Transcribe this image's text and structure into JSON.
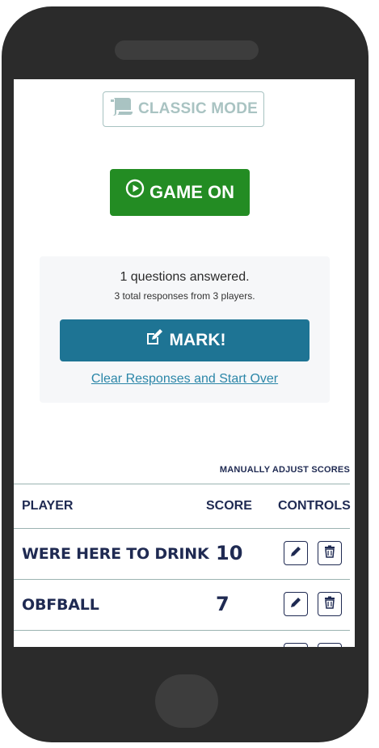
{
  "classic_mode": {
    "label": "CLASSIC MODE",
    "icon": "scroll-icon"
  },
  "game_on": {
    "label": "GAME ON",
    "icon": "play-circle-icon",
    "color": "#238c23"
  },
  "stats": {
    "questions_answered": "1 questions answered.",
    "responses": "3 total responses from 3 players.",
    "mark_label": "MARK!",
    "mark_icon": "edit-icon",
    "mark_color": "#1e7494",
    "clear_link": "Clear Responses and Start Over"
  },
  "scores": {
    "manual_adjust": "MANUALLY ADJUST SCORES",
    "headers": {
      "player": "PLAYER",
      "score": "SCORE",
      "controls": "CONTROLS"
    },
    "rows": [
      {
        "player": "WERE HERE TO DRINK",
        "score": "10"
      },
      {
        "player": "OBFBALL",
        "score": "7"
      }
    ]
  }
}
